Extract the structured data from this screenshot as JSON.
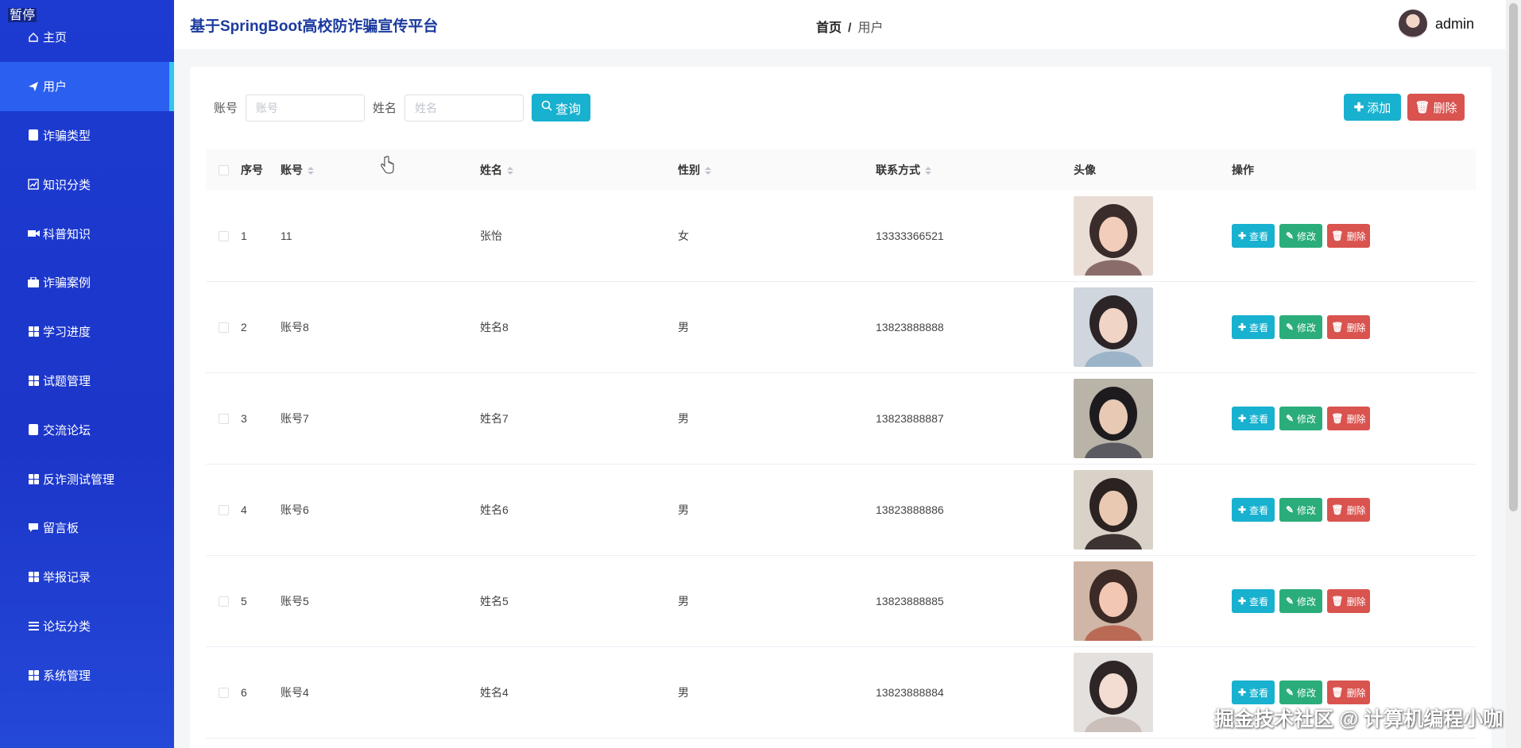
{
  "overlay": {
    "pause_label": "暂停",
    "watermark": "掘金技术社区 @ 计算机编程小咖"
  },
  "sidebar": {
    "items": [
      {
        "label": "主页",
        "icon": "home-icon",
        "active": false
      },
      {
        "label": "用户",
        "icon": "paper-plane-icon",
        "active": true
      },
      {
        "label": "诈骗类型",
        "icon": "clipboard-icon",
        "active": false
      },
      {
        "label": "知识分类",
        "icon": "chart-icon",
        "active": false
      },
      {
        "label": "科普知识",
        "icon": "video-camera-icon",
        "active": false
      },
      {
        "label": "诈骗案例",
        "icon": "briefcase-icon",
        "active": false
      },
      {
        "label": "学习进度",
        "icon": "grid-icon",
        "active": false
      },
      {
        "label": "试题管理",
        "icon": "grid-icon",
        "active": false
      },
      {
        "label": "交流论坛",
        "icon": "clipboard-check-icon",
        "active": false
      },
      {
        "label": "反诈测试管理",
        "icon": "grid-icon",
        "active": false
      },
      {
        "label": "留言板",
        "icon": "comment-icon",
        "active": false
      },
      {
        "label": "举报记录",
        "icon": "grid-icon",
        "active": false
      },
      {
        "label": "论坛分类",
        "icon": "list-icon",
        "active": false
      },
      {
        "label": "系统管理",
        "icon": "grid-icon",
        "active": false
      }
    ]
  },
  "header": {
    "title": "基于SpringBoot高校防诈骗宣传平台",
    "breadcrumb": {
      "home": "首页",
      "separator": "/",
      "current": "用户"
    },
    "username": "admin"
  },
  "search": {
    "account_label": "账号",
    "account_placeholder": "账号",
    "account_value": "",
    "name_label": "姓名",
    "name_placeholder": "姓名",
    "name_value": "",
    "query_label": "查询",
    "add_label": "添加",
    "delete_label": "删除"
  },
  "table": {
    "columns": {
      "idx": "序号",
      "account": "账号",
      "name": "姓名",
      "sex": "性别",
      "phone": "联系方式",
      "avatar": "头像",
      "ops": "操作"
    },
    "op_labels": {
      "view": "查看",
      "edit": "修改",
      "delete": "删除"
    },
    "rows": [
      {
        "idx": "1",
        "account": "11",
        "name": "张怡",
        "sex": "女",
        "phone": "13333366521"
      },
      {
        "idx": "2",
        "account": "账号8",
        "name": "姓名8",
        "sex": "男",
        "phone": "13823888888"
      },
      {
        "idx": "3",
        "account": "账号7",
        "name": "姓名7",
        "sex": "男",
        "phone": "13823888887"
      },
      {
        "idx": "4",
        "account": "账号6",
        "name": "姓名6",
        "sex": "男",
        "phone": "13823888886"
      },
      {
        "idx": "5",
        "account": "账号5",
        "name": "姓名5",
        "sex": "男",
        "phone": "13823888885"
      },
      {
        "idx": "6",
        "account": "账号4",
        "name": "姓名4",
        "sex": "男",
        "phone": "13823888884"
      }
    ]
  },
  "colors": {
    "sidebar": "#1d3bd1",
    "active_item": "#2b5ff0",
    "accent": "#18b1cf",
    "success": "#2aad7a",
    "danger": "#d9534f",
    "title": "#1b3a9e"
  }
}
